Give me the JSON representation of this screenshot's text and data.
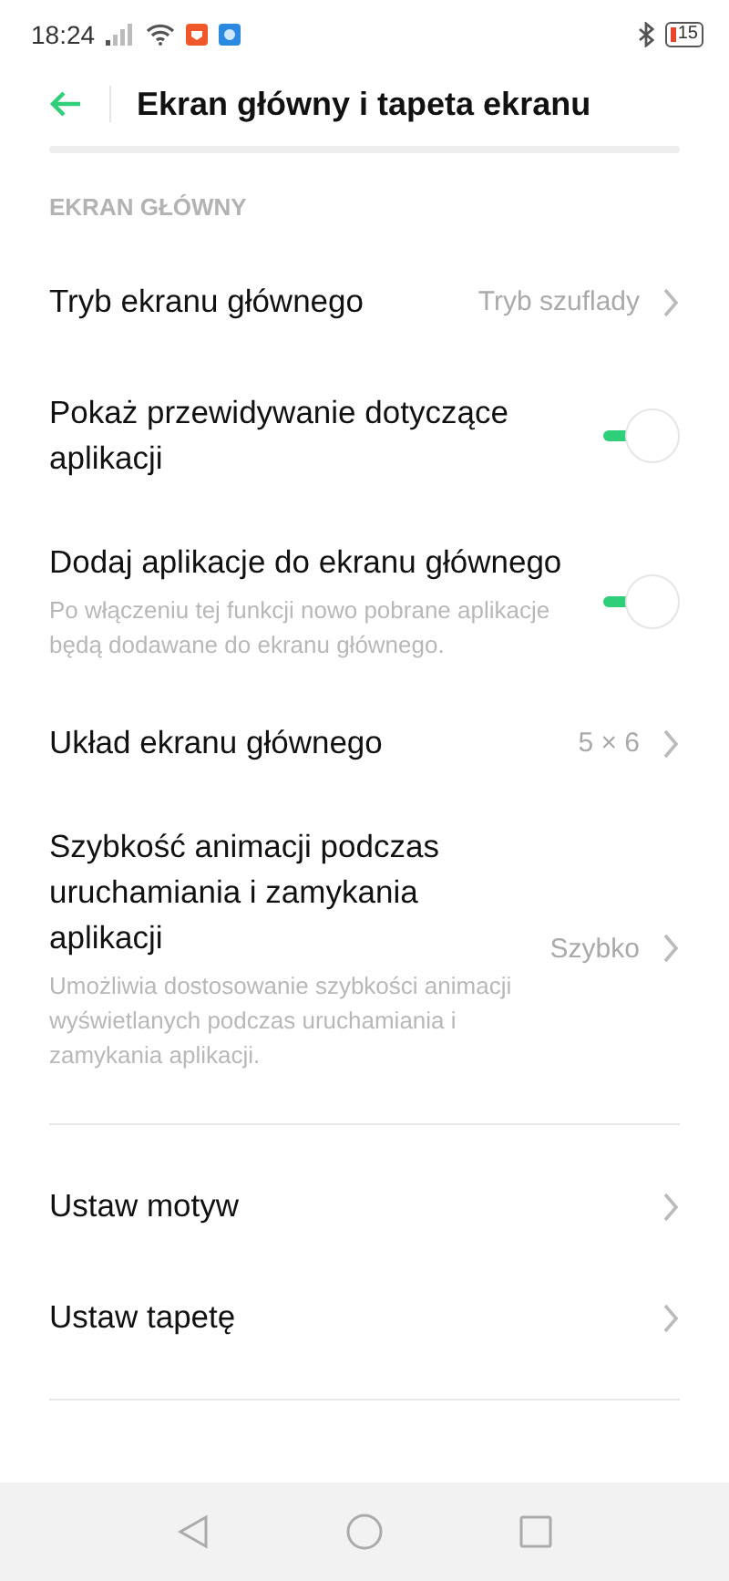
{
  "status_bar": {
    "time": "18:24",
    "battery": "15"
  },
  "header": {
    "title": "Ekran główny i tapeta ekranu"
  },
  "sections": [
    {
      "title": "EKRAN GŁÓWNY",
      "items": [
        {
          "kind": "link",
          "label": "Tryb ekranu głównego",
          "value": "Tryb szuflady"
        },
        {
          "kind": "toggle",
          "label": "Pokaż przewidywanie dotyczące aplikacji",
          "on": true
        },
        {
          "kind": "toggle",
          "label": "Dodaj aplikacje do ekranu głównego",
          "description": "Po włączeniu tej funkcji nowo pobrane aplikacje będą dodawane do ekranu głównego.",
          "on": true
        },
        {
          "kind": "link",
          "label": "Układ ekranu głównego",
          "value": "5 × 6"
        },
        {
          "kind": "link",
          "label": "Szybkość animacji podczas uruchamiania i zamykania aplikacji",
          "description": "Umożliwia dostosowanie szybkości animacji wyświetlanych podczas uruchamiania i zamykania aplikacji.",
          "value": "Szybko"
        }
      ]
    },
    {
      "items": [
        {
          "kind": "link",
          "label": "Ustaw motyw"
        },
        {
          "kind": "link",
          "label": "Ustaw tapetę"
        }
      ]
    }
  ]
}
